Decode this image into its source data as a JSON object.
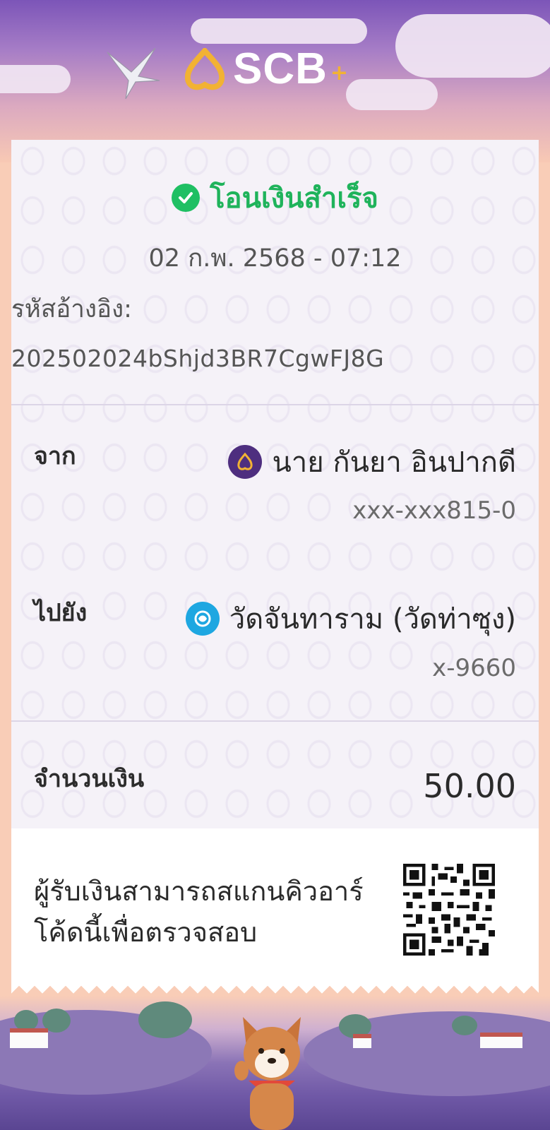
{
  "brand": {
    "name": "SCB",
    "plus": "+"
  },
  "status": {
    "text": "โอนเงินสำเร็จ"
  },
  "datetime": "02 ก.พ. 2568 - 07:12",
  "reference": {
    "label": "รหัสอ้างอิง:",
    "value": "202502024bShjd3BR7CgwFJ8G"
  },
  "from": {
    "label": "จาก",
    "name": "นาย กันยา อินปากดี",
    "account": "xxx-xxx815-0",
    "bank_icon": "scb-bank-icon"
  },
  "to": {
    "label": "ไปยัง",
    "name": "วัดจันทาราม (วัดท่าซุง)",
    "account": "x-9660",
    "bank_icon": "ktb-bank-icon"
  },
  "amount": {
    "label": "จำนวนเงิน",
    "value": "50.00"
  },
  "qr": {
    "text": "ผู้รับเงินสามารถสแกนคิวอาร์โค้ดนี้เพื่อตรวจสอบ",
    "icon": "qr-code"
  },
  "colors": {
    "success": "#1fb35b",
    "brand_purple": "#4e2e7f",
    "sky": "#7c55b8",
    "accent_gold": "#f2b233"
  }
}
